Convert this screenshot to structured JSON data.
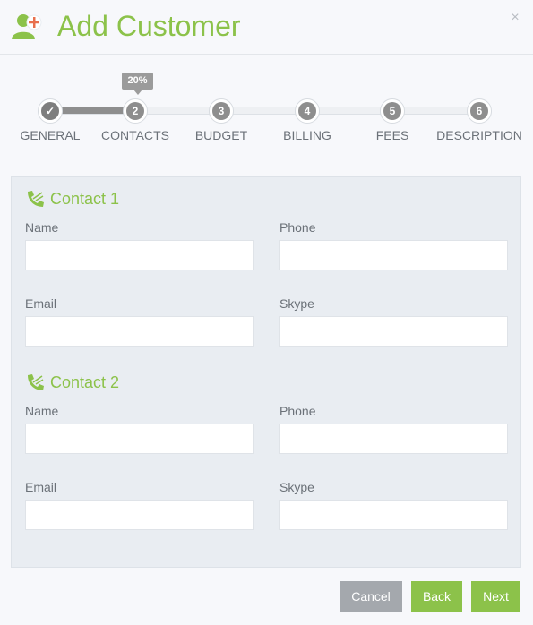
{
  "dialog": {
    "title": "Add Customer",
    "close_glyph": "×"
  },
  "stepper": {
    "progress_label": "20%",
    "progress_fraction": 0.2,
    "steps": [
      {
        "number": "✓",
        "label": "GENERAL",
        "state": "done"
      },
      {
        "number": "2",
        "label": "CONTACTS",
        "state": "current"
      },
      {
        "number": "3",
        "label": "BUDGET",
        "state": "todo"
      },
      {
        "number": "4",
        "label": "BILLING",
        "state": "todo"
      },
      {
        "number": "5",
        "label": "FEES",
        "state": "todo"
      },
      {
        "number": "6",
        "label": "DESCRIPTION",
        "state": "todo"
      }
    ]
  },
  "contacts": [
    {
      "title": "Contact 1",
      "name_label": "Name",
      "name_value": "",
      "phone_label": "Phone",
      "phone_value": "",
      "email_label": "Email",
      "email_value": "",
      "skype_label": "Skype",
      "skype_value": ""
    },
    {
      "title": "Contact 2",
      "name_label": "Name",
      "name_value": "",
      "phone_label": "Phone",
      "phone_value": "",
      "email_label": "Email",
      "email_value": "",
      "skype_label": "Skype",
      "skype_value": ""
    }
  ],
  "footer": {
    "cancel_label": "Cancel",
    "back_label": "Back",
    "next_label": "Next"
  },
  "icons": {
    "header": "add-user-icon",
    "close": "close-icon",
    "section": "phone-icon",
    "step_done": "check-icon"
  },
  "colors": {
    "accent": "#8cc24a",
    "step_active": "#8e8e8e",
    "cancel": "#a4a8ad"
  }
}
